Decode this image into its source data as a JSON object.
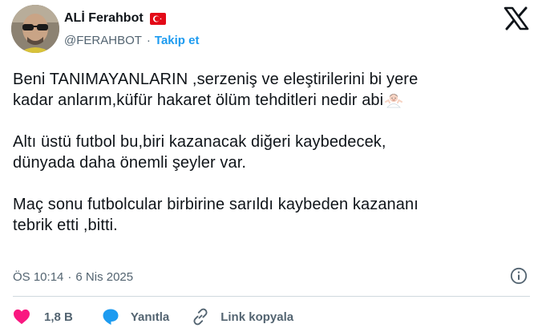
{
  "author": {
    "display_name": "ALİ Ferahbot",
    "handle": "@FERAHBOT",
    "follow_label": "Takip et",
    "flag_icon": "turkey-flag-icon"
  },
  "platform_icon": "x-logo-icon",
  "tweet": {
    "paragraphs": [
      [
        "Beni TANIMAYANLARIN ,serzeniş ve eleştirilerini bi yere",
        "kadar anlarım,küfür hakaret ölüm tehditleri nedir abi"
      ],
      [
        "Altı üstü futbol bu,biri kazanacak diğeri kaybedecek,",
        "dünyada daha önemli şeyler var."
      ],
      [
        "Maç sonu futbolcular birbirine sarıldı kaybeden kazananı",
        "tebrik etti ,bitti."
      ]
    ],
    "emoji": "person-shrugging-emoji"
  },
  "meta": {
    "time": "ÖS 10:14",
    "separator": "·",
    "date": "6 Nis 2025"
  },
  "actions": {
    "like_count": "1,8 B",
    "reply_label": "Yanıtla",
    "copy_link_label": "Link kopyala"
  },
  "colors": {
    "accent": "#1d9bf0",
    "like": "#f91880",
    "text": "#0f1419",
    "muted": "#536471",
    "divider": "#cfd9de"
  }
}
